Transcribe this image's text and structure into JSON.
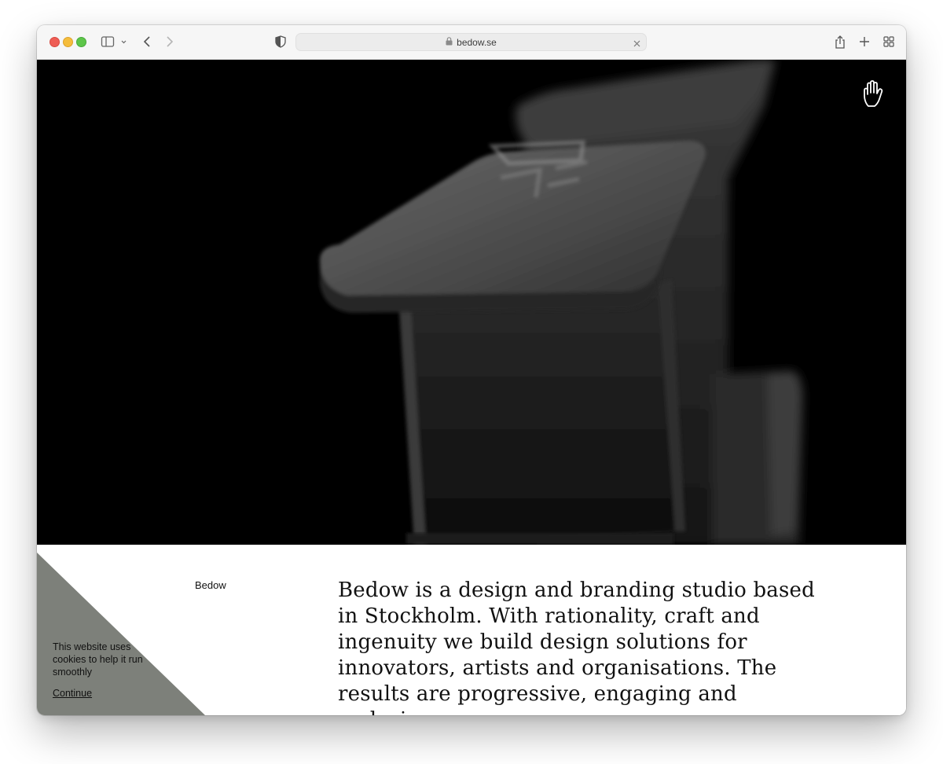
{
  "browser": {
    "url": "bedow.se"
  },
  "icons": {
    "sidebar": "sidebar-icon",
    "back": "chevron-left-icon",
    "forward": "chevron-right-icon",
    "privacy": "shield-icon",
    "lock": "lock-icon",
    "clear": "close-icon",
    "share": "share-icon",
    "new_tab": "plus-icon",
    "tabs": "tab-overview-icon",
    "hand": "hand-icon"
  },
  "colors": {
    "hero_background": "#000000",
    "cookie_panel": "#7d807a",
    "text": "#111111"
  },
  "site": {
    "brand": "Bedow",
    "intro": "Bedow is a design and branding studio based in Stockholm. With rationality, craft and ingenuity we build design solutions for innovators, artists and organisations. The results are progressive, engaging and enduring."
  },
  "cookie": {
    "message": "This website uses cookies to help it run smoothly",
    "continue_label": "Continue"
  }
}
